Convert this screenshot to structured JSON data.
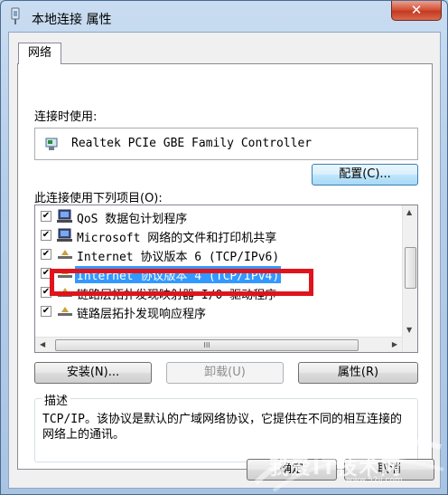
{
  "window": {
    "title": "本地连接 属性",
    "close_label": "✕"
  },
  "tabs": [
    {
      "label": "网络"
    }
  ],
  "connect_using": {
    "label": "连接时使用:",
    "adapter": "Realtek PCIe GBE Family Controller",
    "configure_button": "配置(C)..."
  },
  "items_section": {
    "label": "此连接使用下列项目(O):",
    "items": [
      {
        "label": "QoS 数据包计划程序",
        "checked": true,
        "icon": "qos-icon",
        "selected": false
      },
      {
        "label": "Microsoft 网络的文件和打印机共享",
        "checked": true,
        "icon": "network-share-icon",
        "selected": false
      },
      {
        "label": "Internet 协议版本 6 (TCP/IPv6)",
        "checked": true,
        "icon": "protocol-icon",
        "selected": false
      },
      {
        "label": "Internet 协议版本 4 (TCP/IPv4)",
        "checked": true,
        "icon": "protocol-icon",
        "selected": true
      },
      {
        "label": "链路层拓扑发现映射器 I/O 驱动程序",
        "checked": true,
        "icon": "protocol-icon",
        "selected": false
      },
      {
        "label": "链路层拓扑发现响应程序",
        "checked": true,
        "icon": "protocol-icon",
        "selected": false
      }
    ],
    "hscroll_grip": "III"
  },
  "actions": {
    "install": "安装(N)...",
    "uninstall": "卸载(U)",
    "properties": "属性(R)"
  },
  "description": {
    "title": "描述",
    "text": "TCP/IP。该协议是默认的广域网络协议，它提供在不同的相互连接的网络上的通讯。"
  },
  "footer": {
    "ok": "确定",
    "cancel": "取消"
  },
  "watermark": {
    "text": "我爱IT技术网",
    "sub": "www.52ij.com"
  },
  "colors": {
    "selection": "#3399ff",
    "highlight_box": "#e0141c"
  }
}
